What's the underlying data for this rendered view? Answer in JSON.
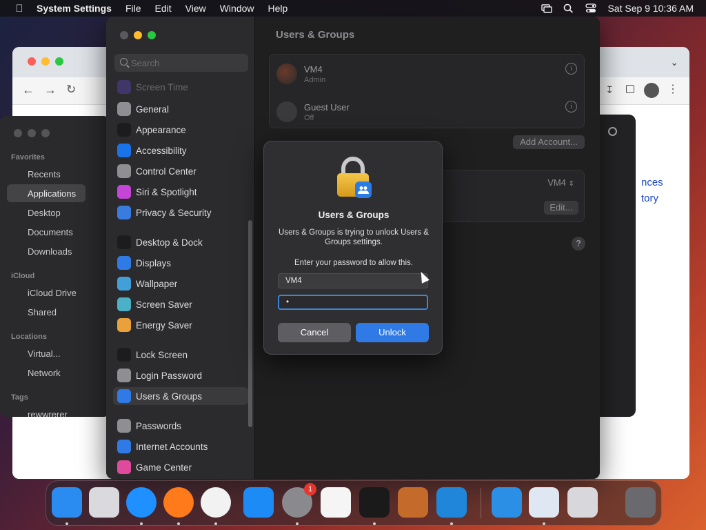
{
  "menubar": {
    "app_name": "System Settings",
    "menus": [
      "File",
      "Edit",
      "View",
      "Window",
      "Help"
    ],
    "datetime": "Sat Sep 9  10:36 AM"
  },
  "settings": {
    "search_placeholder": "Search",
    "sidebar_items": [
      {
        "label": "Screen Time",
        "color": "#6b4bd8"
      },
      {
        "label": "General",
        "color": "#8e8e93"
      },
      {
        "label": "Appearance",
        "color": "#1c1c1e"
      },
      {
        "label": "Accessibility",
        "color": "#1a73e8"
      },
      {
        "label": "Control Center",
        "color": "#8e8e93"
      },
      {
        "label": "Siri & Spotlight",
        "color": "#c445d6"
      },
      {
        "label": "Privacy & Security",
        "color": "#3a7be0"
      },
      {
        "label": "Desktop & Dock",
        "color": "#1c1c1e"
      },
      {
        "label": "Displays",
        "color": "#2f7ae5"
      },
      {
        "label": "Wallpaper",
        "color": "#41a0d8"
      },
      {
        "label": "Screen Saver",
        "color": "#4bb0c8"
      },
      {
        "label": "Energy Saver",
        "color": "#e9a23b"
      },
      {
        "label": "Lock Screen",
        "color": "#1c1c1e"
      },
      {
        "label": "Login Password",
        "color": "#8e8e93"
      },
      {
        "label": "Users & Groups",
        "color": "#2f7ae5"
      },
      {
        "label": "Passwords",
        "color": "#8e8e93"
      },
      {
        "label": "Internet Accounts",
        "color": "#2f7ae5"
      },
      {
        "label": "Game Center",
        "color": "#e04a9c"
      }
    ],
    "selected_item": "Users & Groups",
    "main_title": "Users & Groups",
    "users": [
      {
        "name": "VM4",
        "role": "Admin"
      },
      {
        "name": "Guest User",
        "role": "Off"
      }
    ],
    "add_account_label": "Add Account...",
    "auto_login_value": "VM4",
    "edit_label": "Edit...",
    "help_label": "?"
  },
  "dialog": {
    "title": "Users & Groups",
    "message": "Users & Groups is trying to unlock Users & Groups settings.",
    "prompt": "Enter your password to allow this.",
    "username": "VM4",
    "password_mask": "•",
    "cancel_label": "Cancel",
    "unlock_label": "Unlock"
  },
  "finder": {
    "favorites_header": "Favorites",
    "favorites": [
      "Recents",
      "Applications",
      "Desktop",
      "Documents",
      "Downloads"
    ],
    "icloud_header": "iCloud",
    "icloud": [
      "iCloud Drive",
      "Shared"
    ],
    "locations_header": "Locations",
    "locations": [
      "Virtual...",
      "Network"
    ],
    "tags_header": "Tags",
    "tags": [
      "rewwrerer"
    ]
  },
  "browser": {
    "links": [
      "nces",
      "tory"
    ]
  },
  "dock": {
    "apps": [
      {
        "name": "Finder",
        "color": "#2a8cf0"
      },
      {
        "name": "Launchpad",
        "color": "#d9d9de"
      },
      {
        "name": "Safari",
        "color": "#1e90ff"
      },
      {
        "name": "Firefox",
        "color": "#ff7a1a"
      },
      {
        "name": "Chrome",
        "color": "#f2f2f2"
      },
      {
        "name": "App Store",
        "color": "#1c8bf5"
      },
      {
        "name": "System Settings",
        "color": "#8a8a8e"
      },
      {
        "name": "TextEdit",
        "color": "#f5f5f5"
      },
      {
        "name": "Terminal",
        "color": "#1a1a1a"
      },
      {
        "name": "GarageBand",
        "color": "#c46a2a"
      },
      {
        "name": "VS Code",
        "color": "#1f86d9"
      },
      {
        "name": "Weather",
        "color": "#2b8fe6"
      },
      {
        "name": "VirtualBox",
        "color": "#dfe7f2"
      },
      {
        "name": "Installer",
        "color": "#d8d8dc"
      },
      {
        "name": "Trash",
        "color": "#6a6a6e"
      }
    ],
    "settings_badge": "1"
  }
}
